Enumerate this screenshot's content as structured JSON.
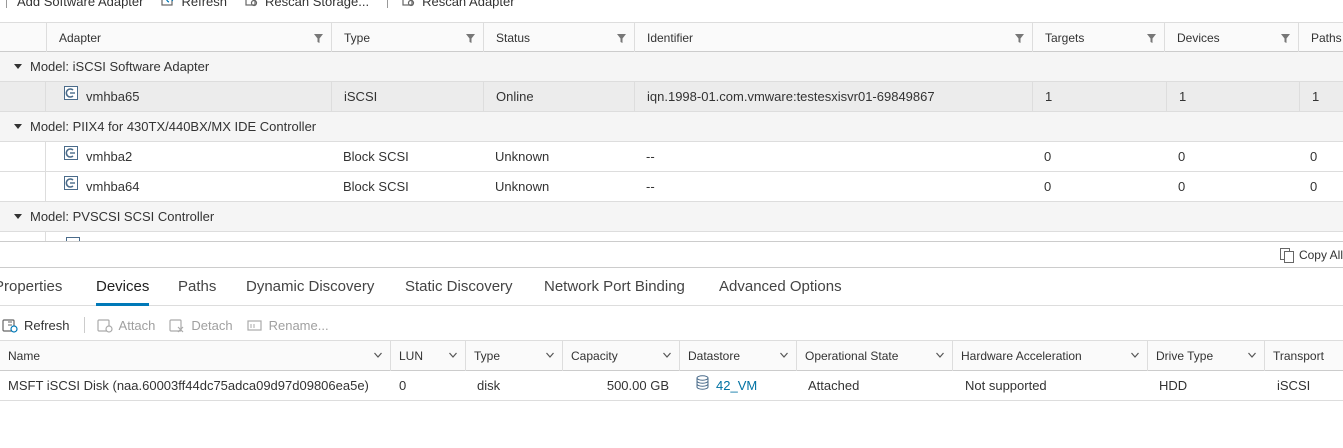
{
  "top_toolbar": {
    "items": [
      {
        "label": "Add Software Adapter",
        "icon": "add-icon"
      },
      {
        "label": "Refresh",
        "icon": "refresh-icon"
      },
      {
        "label": "Rescan Storage...",
        "icon": "rescan-storage-icon"
      },
      {
        "label": "Rescan Adapter",
        "icon": "rescan-adapter-icon"
      }
    ]
  },
  "adapters": {
    "columns": [
      "Adapter",
      "Type",
      "Status",
      "Identifier",
      "Targets",
      "Devices",
      "Paths"
    ],
    "groups": [
      {
        "model": "Model: iSCSI Software Adapter",
        "rows": [
          {
            "adapter": "vmhba65",
            "type": "iSCSI",
            "status": "Online",
            "identifier": "iqn.1998-01.com.vmware:testesxisvr01-69849867",
            "targets": "1",
            "devices": "1",
            "paths": "1",
            "selected": true
          }
        ]
      },
      {
        "model": "Model: PIIX4 for 430TX/440BX/MX IDE Controller",
        "rows": [
          {
            "adapter": "vmhba2",
            "type": "Block SCSI",
            "status": "Unknown",
            "identifier": "--",
            "targets": "0",
            "devices": "0",
            "paths": "0",
            "selected": false
          },
          {
            "adapter": "vmhba64",
            "type": "Block SCSI",
            "status": "Unknown",
            "identifier": "--",
            "targets": "0",
            "devices": "0",
            "paths": "0",
            "selected": false
          }
        ]
      },
      {
        "model": "Model: PVSCSI SCSI Controller",
        "rows": []
      }
    ]
  },
  "copy_all": {
    "label": "Copy All",
    "icon": "copy-icon"
  },
  "tabs": {
    "items": [
      "Properties",
      "Devices",
      "Paths",
      "Dynamic Discovery",
      "Static Discovery",
      "Network Port Binding",
      "Advanced Options"
    ],
    "active": "Devices"
  },
  "devices_toolbar": {
    "refresh": "Refresh",
    "attach": "Attach",
    "detach": "Detach",
    "rename": "Rename..."
  },
  "devices": {
    "columns": [
      "Name",
      "LUN",
      "Type",
      "Capacity",
      "Datastore",
      "Operational State",
      "Hardware Acceleration",
      "Drive Type",
      "Transport"
    ],
    "rows": [
      {
        "name": "MSFT iSCSI Disk (naa.60003ff44dc75adca09d97d09806ea5e)",
        "lun": "0",
        "type": "disk",
        "capacity": "500.00 GB",
        "datastore": "42_VM",
        "state": "Attached",
        "hw_accel": "Not supported",
        "drive_type": "HDD",
        "transport": "iSCSI"
      }
    ]
  },
  "colors": {
    "accent": "#0079b8",
    "link": "#0072a3",
    "selected_row": "#ececec"
  }
}
